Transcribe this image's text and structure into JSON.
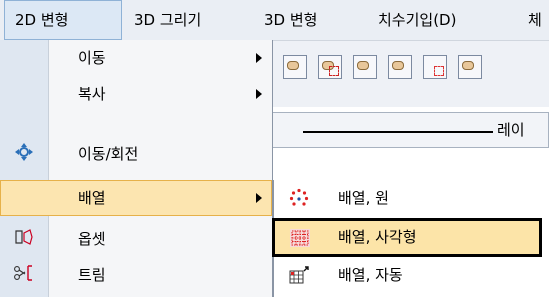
{
  "menubar": {
    "items": [
      {
        "label": "2D 변형"
      },
      {
        "label": "3D 그리기"
      },
      {
        "label": "3D 변형"
      },
      {
        "label": "치수기입(D)"
      },
      {
        "label": "체"
      }
    ]
  },
  "toolbar": {
    "icons": [
      "move-hand-icon",
      "rotate-hand-icon",
      "copy-hand-icon",
      "pan-hand-icon",
      "frame-icon",
      "zoom-hand-icon"
    ]
  },
  "linetype": {
    "label": "레이"
  },
  "menu": {
    "items": [
      {
        "label": "이동",
        "icon": "",
        "has_submenu": true
      },
      {
        "label": "복사",
        "icon": "",
        "has_submenu": true
      },
      {
        "label": "이동/회전",
        "icon": "move-rotate-icon",
        "has_submenu": false
      },
      {
        "label": "배열",
        "icon": "",
        "has_submenu": true,
        "highlighted": true
      },
      {
        "label": "옵셋",
        "icon": "offset-icon",
        "has_submenu": false
      },
      {
        "label": "트림",
        "icon": "trim-icon",
        "has_submenu": false
      }
    ]
  },
  "submenu": {
    "items": [
      {
        "label": "배열, 원",
        "icon": "polar-array-icon"
      },
      {
        "label": "배열, 사각형",
        "icon": "rect-array-icon",
        "highlighted": true
      },
      {
        "label": "배열, 자동",
        "icon": "auto-array-icon"
      }
    ]
  },
  "colors": {
    "menubar_bg": "#eaeef4",
    "active_menu_bg": "#dce8f5",
    "highlight_bg": "#fce5b0",
    "highlight_border": "#e6b14a",
    "icon_column_bg": "#dfe7f1"
  }
}
